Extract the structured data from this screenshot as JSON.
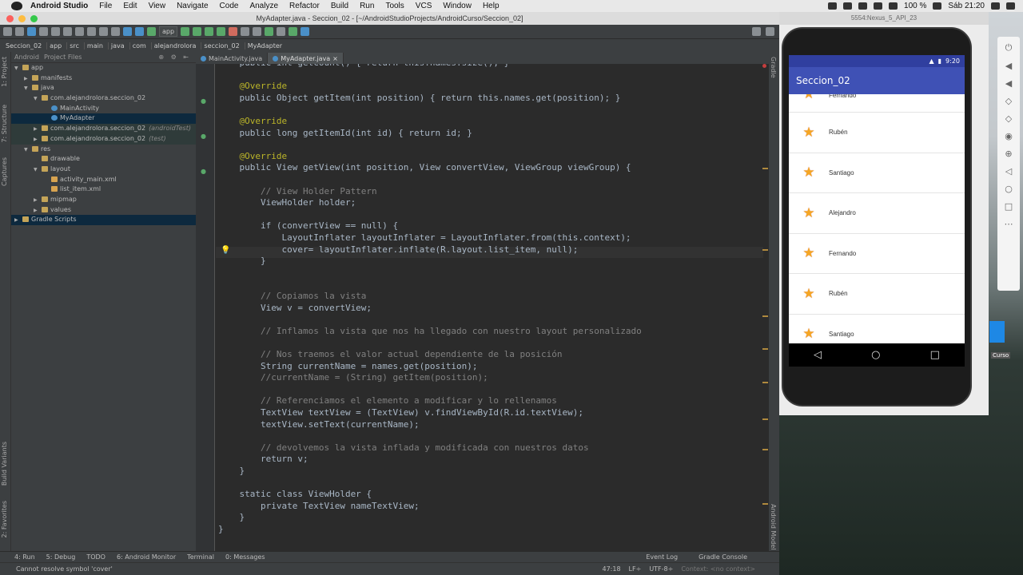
{
  "menubar": {
    "app": "Android Studio",
    "items": [
      "File",
      "Edit",
      "View",
      "Navigate",
      "Code",
      "Analyze",
      "Refactor",
      "Build",
      "Run",
      "Tools",
      "VCS",
      "Window",
      "Help"
    ],
    "battery": "100 %",
    "clock": "Sáb 21:20"
  },
  "window_title": "MyAdapter.java - Seccion_02 - [~/AndroidStudioProjects/AndroidCurso/Seccion_02]",
  "toolbar": {
    "config": "app"
  },
  "breadcrumbs": [
    "Seccion_02",
    "app",
    "src",
    "main",
    "java",
    "com",
    "alejandrolora",
    "seccion_02",
    "MyAdapter"
  ],
  "left_tabs": [
    "1: Project",
    "7: Structure",
    "Captures",
    "Build Variants",
    "2: Favorites"
  ],
  "project": {
    "view_tabs": [
      "Android",
      "Project Files"
    ],
    "tree": [
      {
        "label": "app",
        "indent": 0,
        "twisty": "▼",
        "icon": "folder"
      },
      {
        "label": "manifests",
        "indent": 1,
        "twisty": "▶",
        "icon": "folder"
      },
      {
        "label": "java",
        "indent": 1,
        "twisty": "▼",
        "icon": "folder"
      },
      {
        "label": "com.alejandrolora.seccion_02",
        "indent": 2,
        "twisty": "▼",
        "icon": "folder"
      },
      {
        "label": "MainActivity",
        "indent": 3,
        "twisty": "",
        "icon": "class"
      },
      {
        "label": "MyAdapter",
        "indent": 3,
        "twisty": "",
        "icon": "class",
        "selected": true
      },
      {
        "label": "com.alejandrolora.seccion_02",
        "suffix": "(androidTest)",
        "indent": 2,
        "twisty": "▶",
        "icon": "folder",
        "highlight": true
      },
      {
        "label": "com.alejandrolora.seccion_02",
        "suffix": "(test)",
        "indent": 2,
        "twisty": "▶",
        "icon": "folder",
        "highlight": true
      },
      {
        "label": "res",
        "indent": 1,
        "twisty": "▼",
        "icon": "folder"
      },
      {
        "label": "drawable",
        "indent": 2,
        "twisty": "",
        "icon": "folder"
      },
      {
        "label": "layout",
        "indent": 2,
        "twisty": "▼",
        "icon": "folder"
      },
      {
        "label": "activity_main.xml",
        "indent": 3,
        "twisty": "",
        "icon": "xml"
      },
      {
        "label": "list_item.xml",
        "indent": 3,
        "twisty": "",
        "icon": "xml"
      },
      {
        "label": "mipmap",
        "indent": 2,
        "twisty": "▶",
        "icon": "folder"
      },
      {
        "label": "values",
        "indent": 2,
        "twisty": "▶",
        "icon": "folder"
      },
      {
        "label": "Gradle Scripts",
        "indent": 0,
        "twisty": "▶",
        "icon": "gradle",
        "selected": true
      }
    ]
  },
  "editor_tabs": [
    {
      "label": "MainActivity.java",
      "active": false
    },
    {
      "label": "MyAdapter.java",
      "active": true
    }
  ],
  "code_lines": [
    "    public int getCount() { return this.names.size(); }",
    "",
    "    @Override",
    "    public Object getItem(int position) { return this.names.get(position); }",
    "",
    "    @Override",
    "    public long getItemId(int id) { return id; }",
    "",
    "    @Override",
    "    public View getView(int position, View convertView, ViewGroup viewGroup) {",
    "",
    "        // View Holder Pattern",
    "        ViewHolder holder;",
    "",
    "        if (convertView == null) {",
    "            LayoutInflater layoutInflater = LayoutInflater.from(this.context);",
    "            cover= layoutInflater.inflate(R.layout.list_item, null);",
    "        }",
    "",
    "",
    "        // Copiamos la vista",
    "        View v = convertView;",
    "",
    "        // Inflamos la vista que nos ha llegado con nuestro layout personalizado",
    "",
    "        // Nos traemos el valor actual dependiente de la posición",
    "        String currentName = names.get(position);",
    "        //currentName = (String) getItem(position);",
    "",
    "        // Referenciamos el elemento a modificar y lo rellenamos",
    "        TextView textView = (TextView) v.findViewById(R.id.textView);",
    "        textView.setText(currentName);",
    "",
    "        // devolvemos la vista inflada y modificada con nuestros datos",
    "        return v;",
    "    }",
    "",
    "    static class ViewHolder {",
    "        private TextView nameTextView;",
    "    }",
    "}"
  ],
  "right_tabs": [
    "Gradle",
    "Android Model"
  ],
  "bottom_tabs": [
    "4: Run",
    "5: Debug",
    "TODO",
    "6: Android Monitor",
    "Terminal",
    "0: Messages"
  ],
  "bottom_right_tabs": [
    "Event Log",
    "Gradle Console"
  ],
  "status": {
    "message": "Cannot resolve symbol 'cover'",
    "position": "47:18",
    "line_sep": "LF÷",
    "encoding": "UTF-8÷",
    "context": "Context: <no context>"
  },
  "emulator": {
    "title": "5554:Nexus_5_API_23",
    "time": "9:20",
    "app_title": "Seccion_02",
    "items": [
      "Fernando",
      "Rubén",
      "Santiago",
      "Alejandro",
      "Fernando",
      "Rubén",
      "Santiago"
    ]
  },
  "desktop_label": "Curso",
  "colors": {
    "accent": "#3f51b5",
    "status_bar": "#303f9f",
    "ide_bg": "#2b2b2b"
  }
}
